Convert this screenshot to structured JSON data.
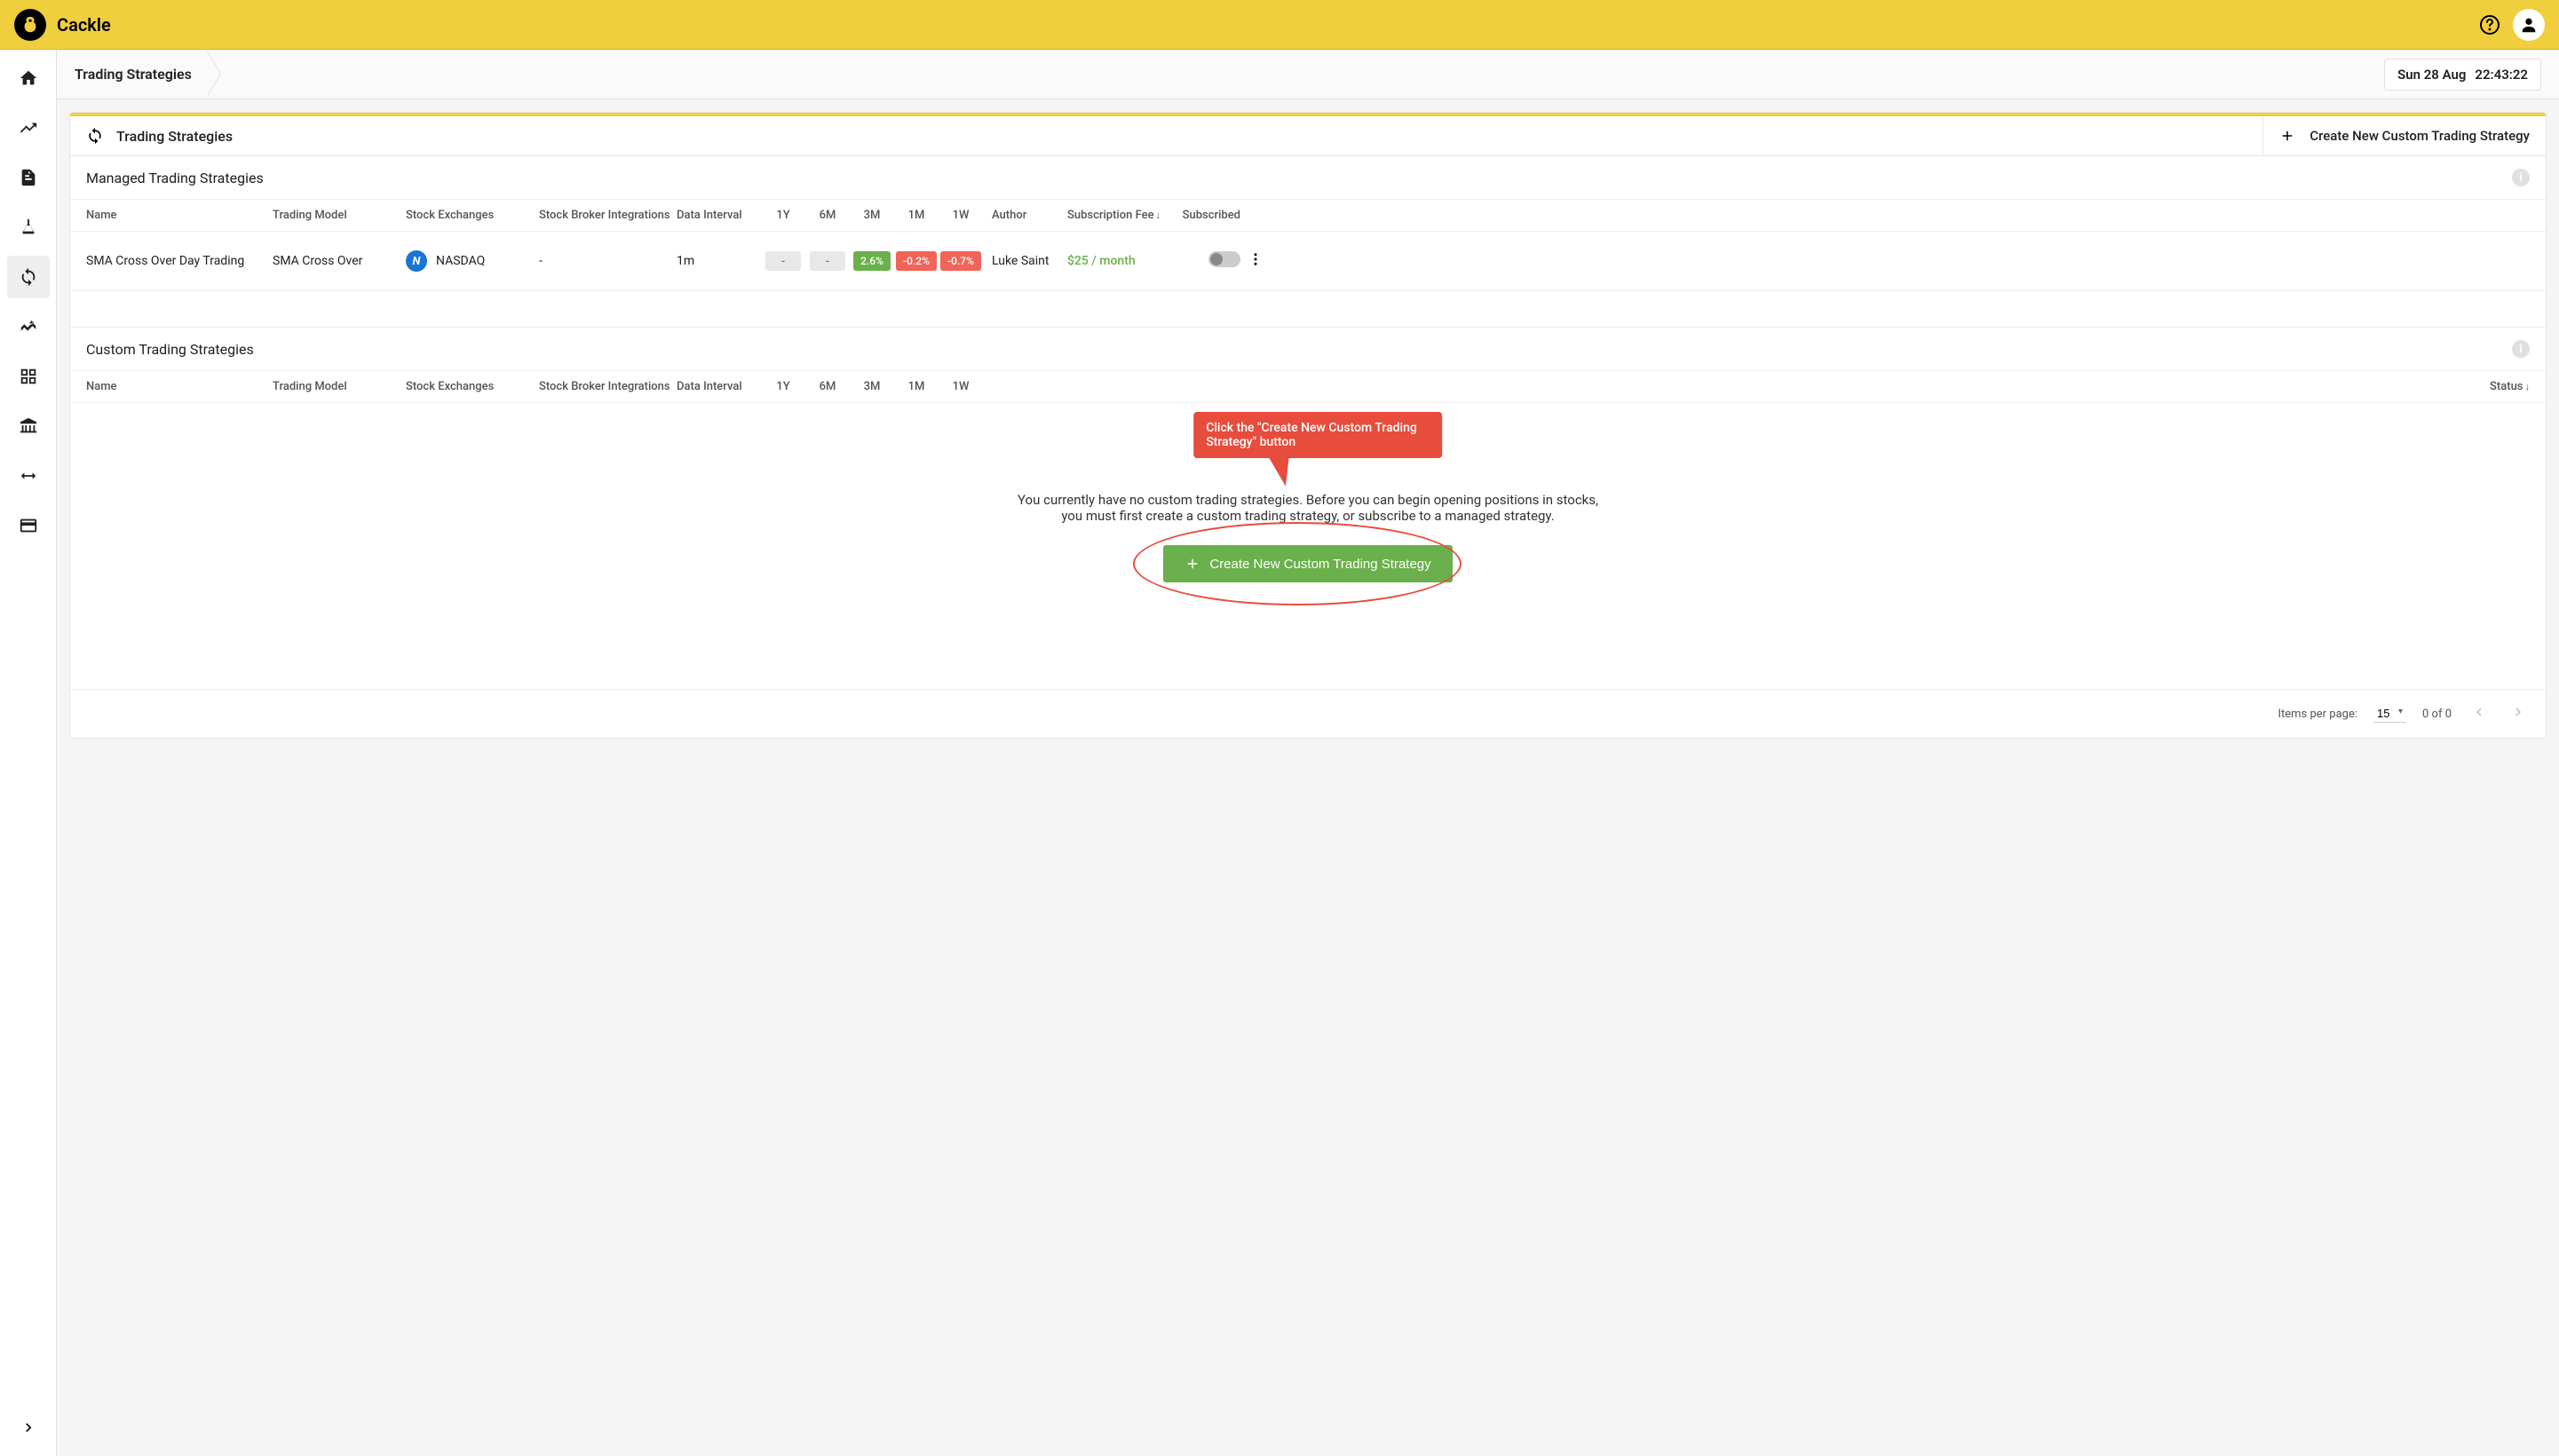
{
  "app": {
    "name": "Cackle"
  },
  "breadcrumb": {
    "title": "Trading Strategies"
  },
  "datetime": {
    "date": "Sun 28 Aug",
    "time": "22:43:22"
  },
  "panel": {
    "title": "Trading Strategies",
    "create_label": "Create New Custom Trading Strategy"
  },
  "managed": {
    "title": "Managed Trading Strategies",
    "columns": {
      "name": "Name",
      "model": "Trading Model",
      "exchanges": "Stock Exchanges",
      "broker": "Stock Broker Integrations",
      "interval": "Data Interval",
      "y1": "1Y",
      "m6": "6M",
      "m3": "3M",
      "m1": "1M",
      "w1": "1W",
      "author": "Author",
      "fee": "Subscription Fee",
      "subscribed": "Subscribed"
    },
    "rows": [
      {
        "name": "SMA Cross Over Day Trading",
        "model": "SMA Cross Over",
        "exchange": "NASDAQ",
        "broker": "-",
        "interval": "1m",
        "y1": "-",
        "m6": "-",
        "m3": "2.6%",
        "m1": "-0.2%",
        "w1": "-0.7%",
        "author": "Luke Saint",
        "fee": "$25 / month"
      }
    ]
  },
  "custom": {
    "title": "Custom Trading Strategies",
    "columns": {
      "name": "Name",
      "model": "Trading Model",
      "exchanges": "Stock Exchanges",
      "broker": "Stock Broker Integrations",
      "interval": "Data Interval",
      "y1": "1Y",
      "m6": "6M",
      "m3": "3M",
      "m1": "1M",
      "w1": "1W",
      "status": "Status"
    },
    "empty_message": "You currently have no custom trading strategies. Before you can begin opening positions in stocks, you must first create a custom trading strategy, or subscribe to a managed strategy.",
    "create_label": "Create New Custom Trading Strategy"
  },
  "callout": {
    "text": "Click the \"Create New Custom Trading Strategy\" button"
  },
  "paginator": {
    "label": "Items per page:",
    "size": "15",
    "range": "0 of 0"
  }
}
